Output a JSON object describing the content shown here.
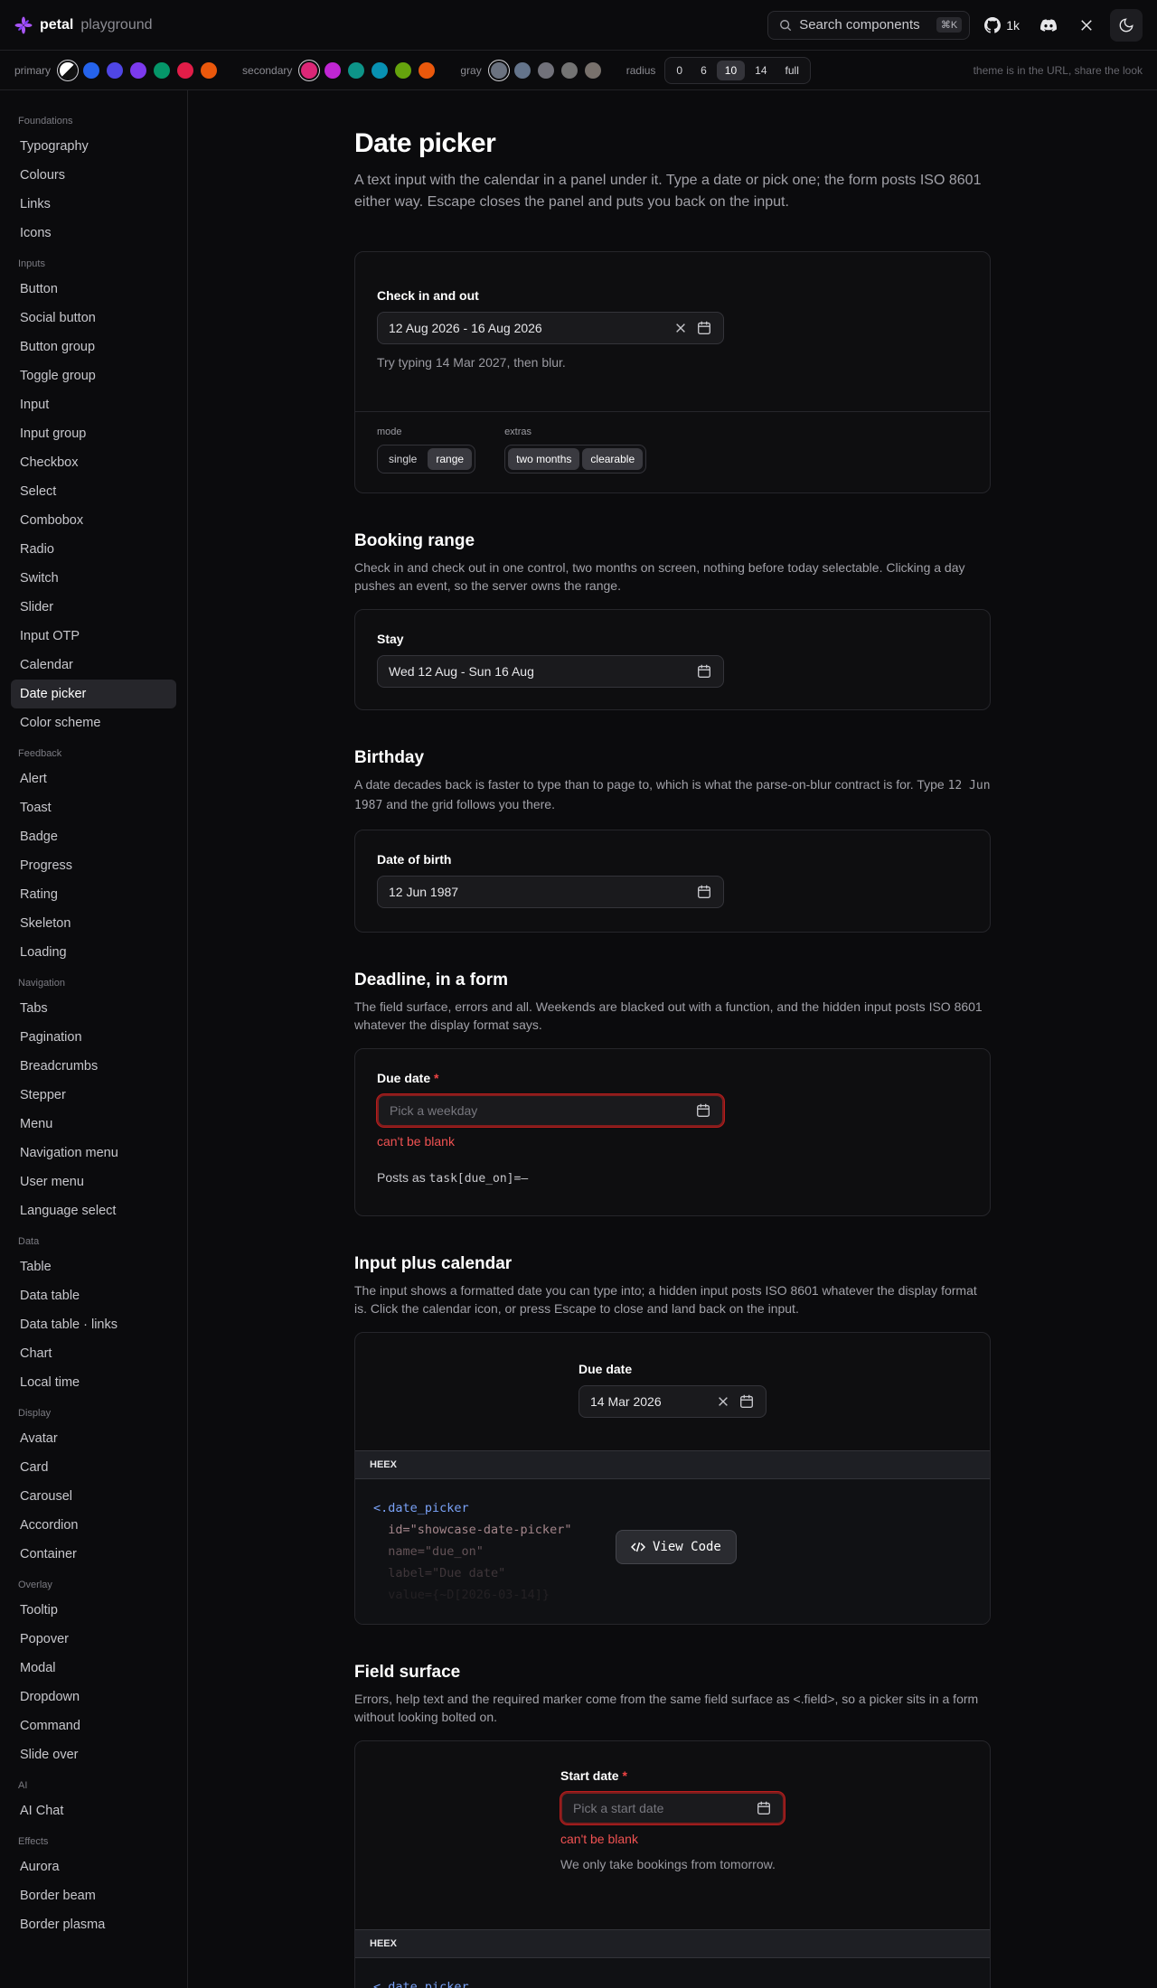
{
  "brand": {
    "name": "petal",
    "subtitle": "playground"
  },
  "header": {
    "search_placeholder": "Search components",
    "search_shortcut": "⌘K",
    "github_count": "1k",
    "icons": [
      "github-icon",
      "discord-icon",
      "x-icon",
      "moon-icon"
    ]
  },
  "themebar": {
    "primary_label": "primary",
    "primary_colors": [
      "#e5e7eb",
      "#2563eb",
      "#4f46e5",
      "#7c3aed",
      "#059669",
      "#e11d48",
      "#ea580c"
    ],
    "secondary_label": "secondary",
    "secondary_colors": [
      "#db2777",
      "#c026d3",
      "#0d9488",
      "#0891b2",
      "#65a30d",
      "#ea580c"
    ],
    "gray_label": "gray",
    "gray_colors": [
      "#6b7280",
      "#64748b",
      "#71717a",
      "#737373",
      "#78716c"
    ],
    "radius_label": "radius",
    "radius_options": [
      "0",
      "6",
      "10",
      "14",
      "full"
    ],
    "radius_selected": "10",
    "note": "theme is in the URL, share the look"
  },
  "sidebar": {
    "groups": [
      {
        "title": "Foundations",
        "items": [
          "Typography",
          "Colours",
          "Links",
          "Icons"
        ]
      },
      {
        "title": "Inputs",
        "items": [
          "Button",
          "Social button",
          "Button group",
          "Toggle group",
          "Input",
          "Input group",
          "Checkbox",
          "Select",
          "Combobox",
          "Radio",
          "Switch",
          "Slider",
          "Input OTP",
          "Calendar",
          "Date picker",
          "Color scheme"
        ]
      },
      {
        "title": "Feedback",
        "items": [
          "Alert",
          "Toast",
          "Badge",
          "Progress",
          "Rating",
          "Skeleton",
          "Loading"
        ]
      },
      {
        "title": "Navigation",
        "items": [
          "Tabs",
          "Pagination",
          "Breadcrumbs",
          "Stepper",
          "Menu",
          "Navigation menu",
          "User menu",
          "Language select"
        ]
      },
      {
        "title": "Data",
        "items": [
          "Table",
          "Data table",
          "Data table · links",
          "Chart",
          "Local time"
        ]
      },
      {
        "title": "Display",
        "items": [
          "Avatar",
          "Card",
          "Carousel",
          "Accordion",
          "Container"
        ]
      },
      {
        "title": "Overlay",
        "items": [
          "Tooltip",
          "Popover",
          "Modal",
          "Dropdown",
          "Command",
          "Slide over"
        ]
      },
      {
        "title": "AI",
        "items": [
          "AI Chat"
        ]
      },
      {
        "title": "Effects",
        "items": [
          "Aurora",
          "Border beam",
          "Border plasma"
        ]
      }
    ],
    "active_item": "Date picker"
  },
  "page": {
    "title": "Date picker",
    "lead": "A text input with the calendar in a panel under it. Type a date or pick one; the form posts ISO 8601 either way. Escape closes the panel and puts you back on the input."
  },
  "demo": {
    "label": "Check in and out",
    "value": "12 Aug 2026 - 16 Aug 2026",
    "hint": "Try typing 14 Mar 2027, then blur.",
    "mode_label": "mode",
    "mode_options": [
      "single",
      "range"
    ],
    "mode_selected": "range",
    "extras_label": "extras",
    "extras_options": [
      "two months",
      "clearable"
    ]
  },
  "booking": {
    "title": "Booking range",
    "desc": "Check in and check out in one control, two months on screen, nothing before today selectable. Clicking a day pushes an event, so the server owns the range.",
    "label": "Stay",
    "value": "Wed 12 Aug - Sun 16 Aug"
  },
  "birthday": {
    "title": "Birthday",
    "desc_before": "A date decades back is faster to type than to page to, which is what the parse-on-blur contract is for. Type ",
    "desc_code": "12 Jun 1987",
    "desc_after": " and the grid follows you there.",
    "label": "Date of birth",
    "value": "12 Jun 1987"
  },
  "deadline": {
    "title": "Deadline, in a form",
    "desc": "The field surface, errors and all. Weekends are blacked out with a function, and the hidden input posts ISO 8601 whatever the display format says.",
    "label": "Due date",
    "required_mark": "*",
    "placeholder": "Pick a weekday",
    "error": "can't be blank",
    "posts_prefix": "Posts as ",
    "posts_code": "task[due_on]=—"
  },
  "input_calendar": {
    "title": "Input plus calendar",
    "desc": "The input shows a formatted date you can type into; a hidden input posts ISO 8601 whatever the display format is. Click the calendar icon, or press Escape to close and land back on the input.",
    "label": "Due date",
    "value": "14 Mar 2026",
    "code_lang": "HEEX",
    "code_lines": [
      "<.date_picker",
      "  id=\"showcase-date-picker\"",
      "  name=\"due_on\"",
      "  label=\"Due date\"",
      "  value={~D[2026-03-14]}"
    ],
    "view_code": "View Code"
  },
  "field_surface": {
    "title": "Field surface",
    "desc": "Errors, help text and the required marker come from the same field surface as <.field>, so a picker sits in a form without looking bolted on.",
    "label": "Start date",
    "required_mark": "*",
    "placeholder": "Pick a start date",
    "error": "can't be blank",
    "help": "We only take bookings from tomorrow.",
    "code_lang": "HEEX",
    "code_first_line": "<.date_picker"
  }
}
